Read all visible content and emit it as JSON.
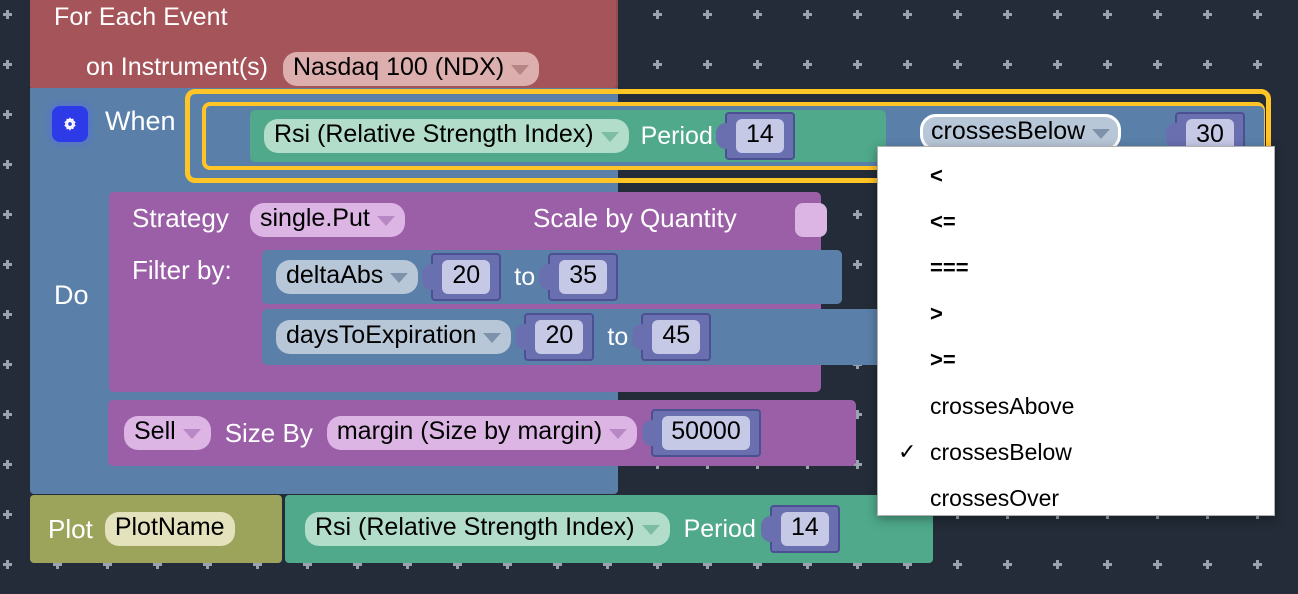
{
  "canvas": {
    "background_color": "#232c38",
    "dot_color": "#9aa3ad",
    "dot_icon": "plus-marker-icon"
  },
  "blocks": {
    "event": {
      "color": "#a5555a",
      "title": "For Each Event",
      "instrument_label": "on Instrument(s)",
      "instrument_value": "Nasdaq 100 (NDX)",
      "caret_icon": "chevron-down-icon"
    },
    "when": {
      "color": "#5a80aa",
      "gear_icon": "gear-icon",
      "label": "When",
      "do_label": "Do",
      "highlight_color": "#ffc425"
    },
    "condition": {
      "indicator_value": "Rsi (Relative Strength Index)",
      "period_label": "Period",
      "period_value": "14",
      "operator_value": "crossesBelow",
      "threshold_value": "30",
      "indicator_color": "#4fa98a"
    },
    "strategy": {
      "color": "#9b5fa8",
      "strategy_label": "Strategy",
      "strategy_value": "single.Put",
      "scale_label": "Scale by Quantity",
      "scale_toggle_state": "off",
      "filter_label": "Filter by:",
      "filters": [
        {
          "field": "deltaAbs",
          "from": "20",
          "to_label": "to",
          "to": "35"
        },
        {
          "field": "daysToExpiration",
          "from": "20",
          "to_label": "to",
          "to": "45"
        }
      ],
      "order": {
        "side": "Sell",
        "size_by_label": "Size By",
        "size_by_value": "margin (Size by margin)",
        "size_amount": "50000"
      }
    },
    "plot": {
      "color": "#9ca45c",
      "label": "Plot",
      "name_value": "PlotName",
      "indicator_value": "Rsi (Relative Strength Index)",
      "period_label": "Period",
      "period_value": "14"
    }
  },
  "dropdown": {
    "open": true,
    "selected": "crossesBelow",
    "check_icon": "checkmark-icon",
    "items": [
      {
        "label": "<",
        "symbol": true,
        "checked": false
      },
      {
        "label": "<=",
        "symbol": true,
        "checked": false
      },
      {
        "label": "===",
        "symbol": true,
        "checked": false
      },
      {
        "label": ">",
        "symbol": true,
        "checked": false
      },
      {
        "label": ">=",
        "symbol": true,
        "checked": false
      },
      {
        "label": "crossesAbove",
        "symbol": false,
        "checked": false
      },
      {
        "label": "crossesBelow",
        "symbol": false,
        "checked": true
      },
      {
        "label": "crossesOver",
        "symbol": false,
        "checked": false
      }
    ]
  }
}
